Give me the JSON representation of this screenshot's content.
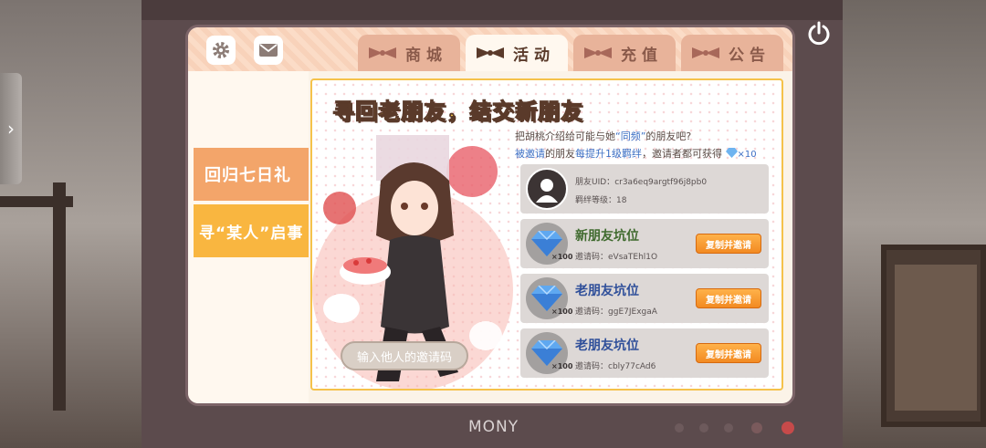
{
  "monitor": {
    "brand": "MONY"
  },
  "header": {
    "tabs": [
      {
        "label": "商城"
      },
      {
        "label": "活动"
      },
      {
        "label": "充值"
      },
      {
        "label": "公告"
      }
    ]
  },
  "sidebar": {
    "items": [
      {
        "label": "回归七日礼"
      },
      {
        "label": "寻“某人”启事"
      }
    ]
  },
  "content": {
    "title": "寻回老朋友，结交新朋友",
    "intro_line1_prefix": "把胡桃介绍给可能与她",
    "intro_line1_highlight": "“同频”",
    "intro_line1_suffix": "的朋友吧?",
    "intro_line2_part1": "被邀请",
    "intro_line2_part2": "的朋友",
    "intro_line2_part3": "每提升1级羁绊",
    "intro_line2_part4": "，邀请者都可获得",
    "intro_gem_amount": "×10",
    "invite_input_placeholder": "输入他人的邀请码",
    "friend": {
      "uid_label": "朋友UID：",
      "uid_value": "cr3a6eq9argtf96j8pb0",
      "level_label": "羁绊等级：",
      "level_value": "18"
    },
    "slots": [
      {
        "title": "新朋友坑位",
        "code_label": "邀请码：",
        "code_value": "eVsaTEhl1O",
        "gem_qty": "×100",
        "button": "复制并邀请"
      },
      {
        "title": "老朋友坑位",
        "code_label": "邀请码：",
        "code_value": "ggE7JExgaA",
        "gem_qty": "×100",
        "button": "复制并邀请"
      },
      {
        "title": "老朋友坑位",
        "code_label": "邀请码：",
        "code_value": "cbly77cAd6",
        "gem_qty": "×100",
        "button": "复制并邀请"
      }
    ]
  },
  "icons": {
    "settings": "gear-icon",
    "mail": "mail-icon",
    "power": "power-icon",
    "side_arrow": "chevron-right-icon",
    "gem": "diamond-icon"
  },
  "colors": {
    "accent_orange": "#f3a56a",
    "accent_yellow": "#f9b640",
    "button_orange": "#f28a22",
    "title_yellow": "#ffd24a"
  }
}
